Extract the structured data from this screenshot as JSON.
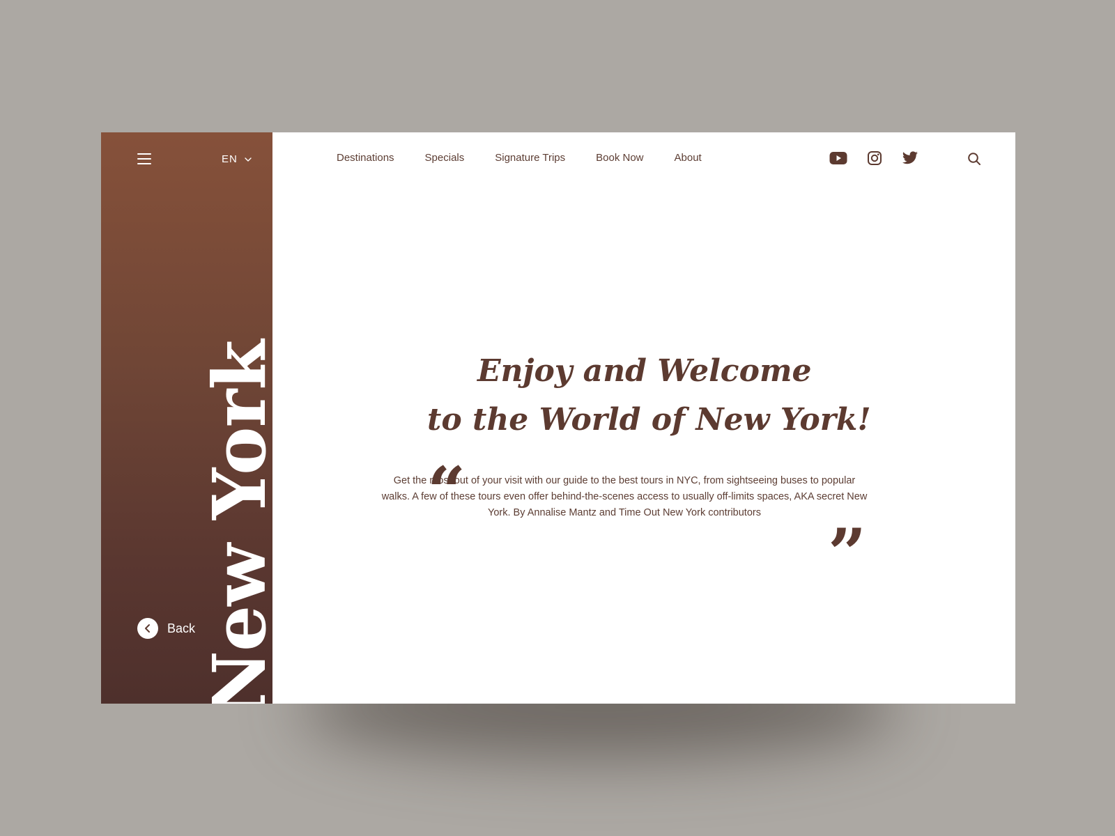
{
  "sidebar": {
    "language": "EN",
    "vertical_title": "New York",
    "back_label": "Back"
  },
  "nav": {
    "items": [
      "Destinations",
      "Specials",
      "Signature Trips",
      "Book Now",
      "About"
    ]
  },
  "social": {
    "icons": [
      "youtube-icon",
      "instagram-icon",
      "twitter-icon"
    ]
  },
  "hero": {
    "quote_open": "“",
    "quote_close": "”",
    "headline_line1": "Enjoy and Welcome",
    "headline_line2": "to the World of New York!",
    "body": "Get the most out of your visit with our guide to the best tours in NYC, from sightseeing buses to popular walks. A few of these tours even offer behind-the-scenes access to usually off-limits spaces, AKA secret New York. By Annalise Mantz and Time Out New York contributors"
  },
  "colors": {
    "background": "#aca8a3",
    "sidebar_top": "#86513a",
    "sidebar_bottom": "#4e302c",
    "accent_text": "#5c3a30"
  }
}
